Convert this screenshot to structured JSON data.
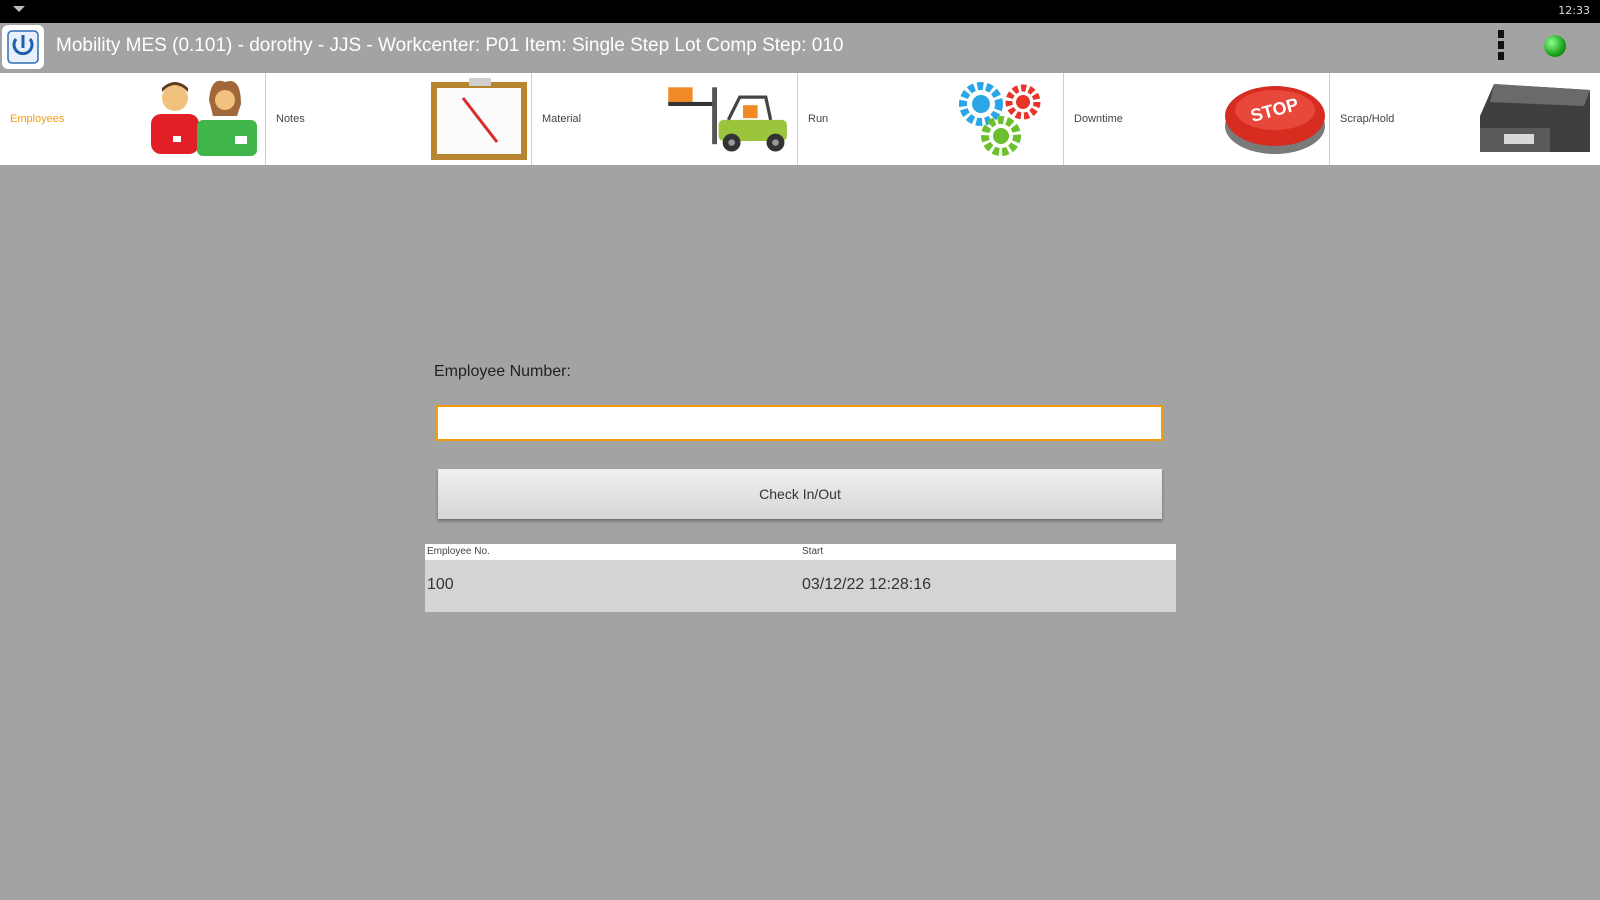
{
  "status_bar": {
    "time": "12:33"
  },
  "app": {
    "title": "Mobility MES (0.101) - dorothy - JJS - Workcenter: P01 Item: Single Step Lot Comp Step: 010",
    "logo_icon": "mobility-mes-logo",
    "connection_status_color": "#22aa22"
  },
  "tabs": [
    {
      "label": "Employees",
      "icon": "employees-icon",
      "active": true
    },
    {
      "label": "Notes",
      "icon": "clipboard-icon",
      "active": false
    },
    {
      "label": "Material",
      "icon": "forklift-icon",
      "active": false
    },
    {
      "label": "Run",
      "icon": "gears-icon",
      "active": false
    },
    {
      "label": "Downtime",
      "icon": "stop-button-icon",
      "active": false
    },
    {
      "label": "Scrap/Hold",
      "icon": "reject-tray-icon",
      "active": false
    }
  ],
  "form": {
    "employee_number_label": "Employee Number:",
    "employee_number_value": "",
    "check_button_label": "Check In/Out"
  },
  "table": {
    "headers": [
      "Employee No.",
      "Start"
    ],
    "rows": [
      {
        "employee_no": "100",
        "start": "03/12/22 12:28:16"
      }
    ]
  },
  "colors": {
    "accent": "#f39c12",
    "background": "#a3a3a3",
    "active_tab_text": "#f39c12"
  }
}
